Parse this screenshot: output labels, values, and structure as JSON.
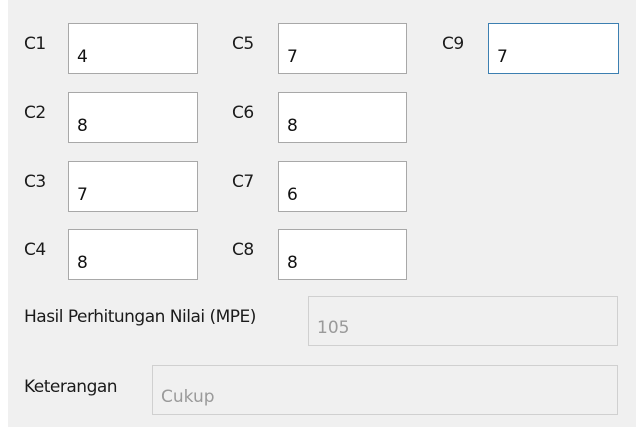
{
  "criteria": [
    {
      "label": "C1",
      "value": "4"
    },
    {
      "label": "C2",
      "value": "8"
    },
    {
      "label": "C3",
      "value": "7"
    },
    {
      "label": "C4",
      "value": "8"
    },
    {
      "label": "C5",
      "value": "7"
    },
    {
      "label": "C6",
      "value": "8"
    },
    {
      "label": "C7",
      "value": "6"
    },
    {
      "label": "C8",
      "value": "8"
    },
    {
      "label": "C9",
      "value": "7"
    }
  ],
  "result": {
    "label": "Hasil Perhitungan Nilai (MPE)",
    "value": "105"
  },
  "remark": {
    "label": "Keterangan",
    "value": "Cukup"
  },
  "colors": {
    "panel_background": "#f0f0f0",
    "focused_border": "#3c7fb1",
    "readonly_text": "#9a9a9a"
  }
}
